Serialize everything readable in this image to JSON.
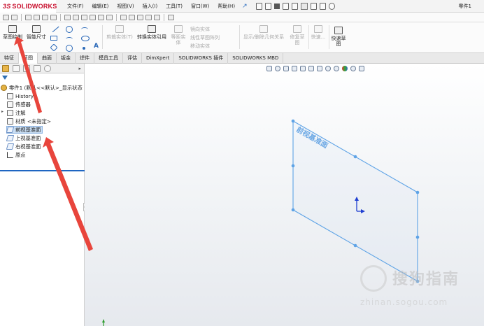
{
  "app": {
    "logo_ds": "3S",
    "logo_name": "SOLIDWORKS",
    "document_title": "零件1"
  },
  "menu": {
    "items": [
      "文件(F)",
      "编辑(E)",
      "视图(V)",
      "插入(I)",
      "工具(T)",
      "窗口(W)",
      "帮助(H)"
    ]
  },
  "ribbon": {
    "sketch_label": "草图绘制",
    "smart_dim_label": "智能尺寸",
    "trim_label": "剪裁实体(T)",
    "convert_label": "转换实体引用",
    "offset_label_1": "等距实",
    "offset_label_2": "体",
    "mirror_label": "镜向实体",
    "linear_pattern_label": "线性草图阵列",
    "move_label": "移动实体",
    "display_relations_label": "显示/删除几何关系",
    "repair_label_1": "修复草",
    "repair_label_2": "图",
    "quick_snap_label": "快速...",
    "rapid_sketch_label_1": "快速草",
    "rapid_sketch_label_2": "图",
    "text_tool": "A"
  },
  "tabs": [
    "特征",
    "草图",
    "曲面",
    "钣金",
    "焊件",
    "模具工具",
    "评估",
    "DimXpert",
    "SOLIDWORKS 插件",
    "SOLIDWORKS MBD"
  ],
  "active_tab": 1,
  "tree": {
    "root": "零件1 (默认<<默认>_显示状态",
    "items": {
      "history": "History",
      "sensors": "传感器",
      "annotations": "注解",
      "material": "材质 <未指定>",
      "front_plane": "前视基准面",
      "top_plane": "上视基准面",
      "right_plane": "右视基准面",
      "origin": "原点"
    }
  },
  "graphics": {
    "plane_label": "前视基准面"
  },
  "watermark": {
    "text": "搜狗指南",
    "sub": "zhinan.sogou.com"
  },
  "colors": {
    "accent": "#2a68b8",
    "plane_edge": "#5ea3e6",
    "annotation_arrow": "#e8453c",
    "selected_row": "#c9def4"
  }
}
